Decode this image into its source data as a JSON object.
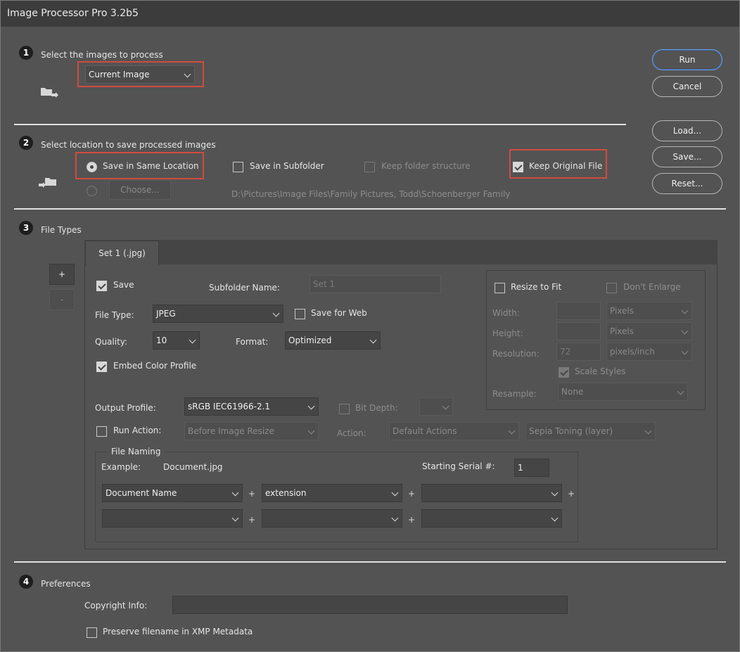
{
  "window": {
    "title": "Image Processor Pro 3.2b5"
  },
  "buttons": {
    "run": "Run",
    "cancel": "Cancel",
    "load": "Load...",
    "save": "Save...",
    "reset": "Reset..."
  },
  "step1": {
    "num": "1",
    "label": "Select the images to process",
    "source_select": "Current Image"
  },
  "step2": {
    "num": "2",
    "label": "Select location to save processed images",
    "save_same": "Save in Same Location",
    "choose": "Choose...",
    "save_subfolder": "Save in Subfolder",
    "keep_structure": "Keep folder structure",
    "keep_original": "Keep Original File",
    "path": "D:\\Pictures\\Image Files\\Family Pictures, Todd\\Schoenberger Family"
  },
  "step3": {
    "num": "3",
    "label": "File Types",
    "plus": "+",
    "minus": "-",
    "tab": "Set 1 (.jpg)",
    "save_label": "Save",
    "subfolder_label": "Subfolder Name:",
    "subfolder_placeholder": "Set 1",
    "file_type_label": "File Type:",
    "file_type": "JPEG",
    "save_for_web": "Save for Web",
    "quality_label": "Quality:",
    "quality": "10",
    "format_label": "Format:",
    "format": "Optimized",
    "embed_profile": "Embed Color Profile",
    "resize": {
      "resize_to_fit": "Resize to Fit",
      "dont_enlarge": "Don't Enlarge",
      "width_label": "Width:",
      "height_label": "Height:",
      "resolution_label": "Resolution:",
      "width_unit": "Pixels",
      "height_unit": "Pixels",
      "resolution_value": "72",
      "resolution_unit": "pixels/inch",
      "scale_styles": "Scale Styles",
      "resample_label": "Resample:",
      "resample": "None"
    },
    "output_profile_label": "Output Profile:",
    "output_profile": "sRGB IEC61966-2.1",
    "bit_depth": "Bit Depth:",
    "run_action": "Run Action:",
    "run_action_value": "Before Image Resize",
    "action_label": "Action:",
    "action_set": "Default Actions",
    "action_name": "Sepia Toning (layer)",
    "naming": {
      "legend": "File Naming",
      "example_label": "Example:",
      "example": "Document.jpg",
      "serial_label": "Starting Serial #:",
      "serial": "1",
      "field1": "Document Name",
      "field2": "extension",
      "plus": "+"
    }
  },
  "step4": {
    "num": "4",
    "label": "Preferences",
    "copyright_label": "Copyright Info:",
    "preserve_filename": "Preserve filename in XMP Metadata"
  }
}
